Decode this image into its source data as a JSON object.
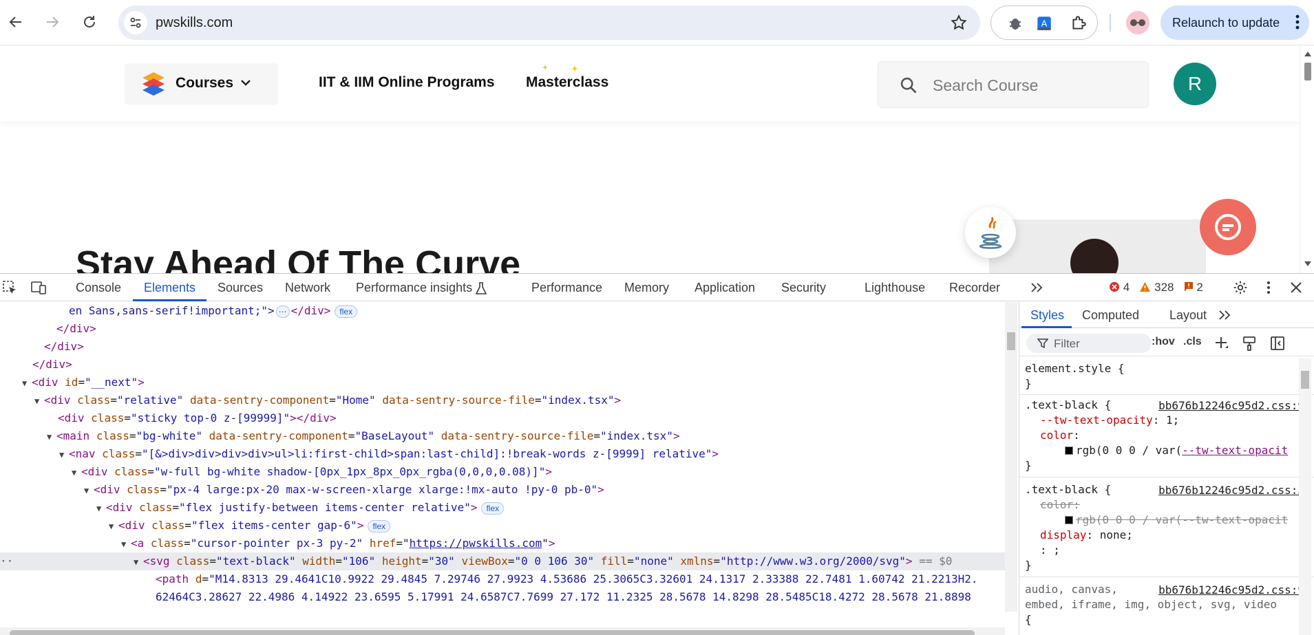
{
  "browser": {
    "url": "pwskills.com",
    "relaunch_label": "Relaunch to update",
    "icons": [
      "back-icon",
      "forward-icon",
      "reload-icon",
      "site-info-icon",
      "bookmark-star-icon",
      "bug-extension-icon",
      "translate-extension-icon",
      "extensions-puzzle-icon",
      "profile-icon",
      "menu-dots-icon"
    ]
  },
  "site": {
    "courses_label": "Courses",
    "nav_links": [
      "IIT & IIM Online Programs",
      "Masterclass"
    ],
    "search_placeholder": "Search Course",
    "avatar_initial": "R",
    "hero_title": "Stay Ahead Of The Curve",
    "accent_color": "#0e8a7b",
    "chat_color": "#ee6b5f"
  },
  "devtools": {
    "tabs": [
      "Console",
      "Elements",
      "Sources",
      "Network",
      "Performance insights",
      "Performance",
      "Memory",
      "Application",
      "Security",
      "Lighthouse",
      "Recorder"
    ],
    "active_tab": "Elements",
    "errors": "4",
    "warnings": "328",
    "infos": "2",
    "styles_tabs": [
      "Styles",
      "Computed",
      "Layout"
    ],
    "filter_placeholder": "Filter",
    "hov": ":hov",
    "cls": ".cls",
    "badge_flex": "flex",
    "selected_marker": "== $0"
  },
  "dom": {
    "l0_text": "en Sans,sans-serif!important;\">",
    "l0_close": "</div>",
    "l1": "</div>",
    "l2": "</div>",
    "l3": "</div>",
    "l4_tag": "<div",
    "l4_attr": "id",
    "l4_val": "\"__next\"",
    "l5_tag": "<div",
    "l5_attrs": [
      [
        "class",
        "\"relative\""
      ],
      [
        "data-sentry-component",
        "\"Home\""
      ],
      [
        "data-sentry-source-file",
        "\"index.tsx\""
      ]
    ],
    "l6": "<div class=\"sticky top-0 z-[99999]\"></div>",
    "l6_tag": "<div",
    "l6_attr": "class",
    "l6_val": "\"sticky top-0 z-[99999]\"",
    "l6_end": "></div>",
    "l7_tag": "<main",
    "l7_attrs": [
      [
        "class",
        "\"bg-white\""
      ],
      [
        "data-sentry-component",
        "\"BaseLayout\""
      ],
      [
        "data-sentry-source-file",
        "\"index.tsx\""
      ]
    ],
    "l8_tag": "<nav",
    "l8_attr": "class",
    "l8_val": "\"[&>div>div>div>div>ul>li:first-child>span:last-child]:!break-words z-[9999] relative\"",
    "l9_tag": "<div",
    "l9_attr": "class",
    "l9_val": "\"w-full bg-white shadow-[0px_1px_8px_0px_rgba(0,0,0,0.08)]\"",
    "l10_tag": "<div",
    "l10_attr": "class",
    "l10_val": "\"px-4 large:px-20 max-w-screen-xlarge xlarge:!mx-auto !py-0 pb-0\"",
    "l11_tag": "<div",
    "l11_attr": "class",
    "l11_val": "\"flex justify-between items-center relative\"",
    "l12_tag": "<div",
    "l12_attr": "class",
    "l12_val": "\"flex items-center gap-6\"",
    "l13_tag": "<a",
    "l13_attrs": [
      [
        "class",
        "\"cursor-pointer px-3 py-2\""
      ]
    ],
    "l13_href_attr": "href",
    "l13_href": "https://pwskills.com",
    "l14_tag": "<svg",
    "l14_attrs": [
      [
        "class",
        "\"text-black\""
      ],
      [
        "width",
        "\"106\""
      ],
      [
        "height",
        "\"30\""
      ],
      [
        "viewBox",
        "\"0 0 106 30\""
      ],
      [
        "fill",
        "\"none\""
      ],
      [
        "xmlns",
        "\"http://www.w3.org/2000/svg\""
      ]
    ],
    "l15_tag": "<path",
    "l15_attr": "d",
    "l15_val": "\"M14.8313 29.4641C10.9922 29.4845 7.29746 27.9923 4.53686 25.3065C3.32601 24.1317 2.33388 22.7481 1.60742 21.2213H2.",
    "l16_text": "62464C3.28627 22.4986 4.14922 23.6595 5.17991 24.6587C7.7699 27.172 11.2325 28.5678 14.8298 28.5485C18.4272 28.5678 21.8898"
  },
  "styles": {
    "element_style": "element.style {",
    "close_brace": "}",
    "r1_selector": ".text-black {",
    "r1_src": "bb676b12246c95d2.css:9",
    "r1_p1_name": "--tw-text-opacity",
    "r1_p1_val": "1;",
    "r1_p2_name": "color",
    "r1_p2_val": "rgb(0 0 0 / var(",
    "r1_p2_var": "--tw-text-opacit",
    "r2_selector": ".text-black {",
    "r2_src": "bb676b12246c95d2.css:5",
    "r2_p1": "color:",
    "r2_p1_val": "rgb(0 0 0 / var(",
    "r2_p1_var": "--tw-text-opacit",
    "r2_p2_name": "display",
    "r2_p2_val": "none;",
    "r2_p3": ": ;",
    "r3_selector": "audio, canvas,",
    "r3_src": "bb676b12246c95d2.css:9",
    "r3_selector_2": "embed, iframe, img, object, svg, video",
    "r3_brace": "{"
  }
}
